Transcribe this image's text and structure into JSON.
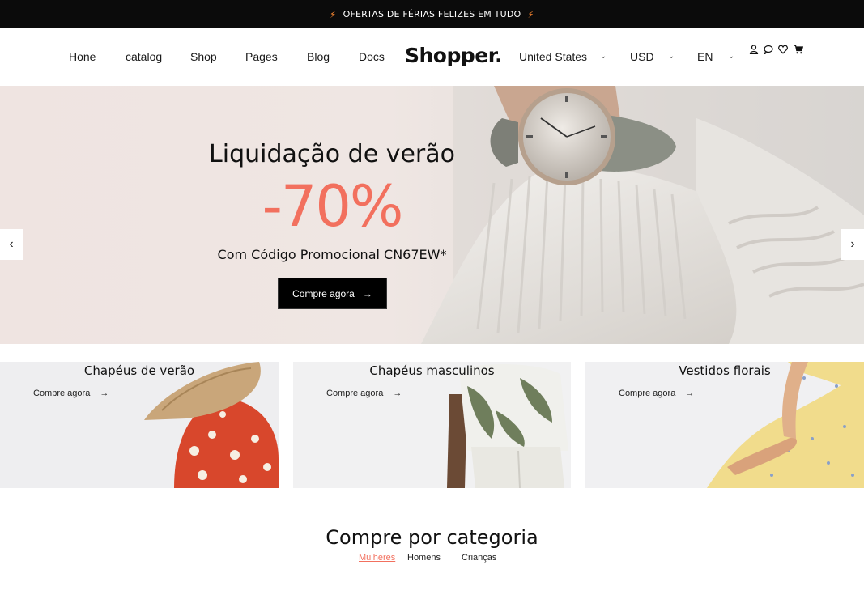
{
  "promo": {
    "text": "OFERTAS DE FÉRIAS FELIZES EM TUDO",
    "bolt": "⚡"
  },
  "nav": {
    "links": [
      "Hone",
      "catalog",
      "Shop",
      "Pages",
      "Blog",
      "Docs"
    ],
    "logo": "Shopper.",
    "country": "United States",
    "currency": "USD",
    "language": "EN",
    "icons": [
      "user-icon",
      "chat-icon",
      "heart-icon",
      "cart-icon"
    ]
  },
  "hero": {
    "title": "Liquidação de verão",
    "discount": "-70%",
    "subtitle": "Com Código Promocional CN67EW*",
    "button": "Compre agora",
    "prev": "‹",
    "next": "›",
    "accent_color": "#f2705e"
  },
  "tiles": [
    {
      "title": "Chapéus de verão",
      "link": "Compre agora"
    },
    {
      "title": "Chapéus masculinos",
      "link": "Compre agora"
    },
    {
      "title": "Vestidos florais",
      "link": "Compre agora"
    }
  ],
  "categories": {
    "title": "Compre por categoria",
    "tabs": [
      "Mulheres",
      "Homens",
      "Crianças"
    ],
    "active_tab": "Mulheres"
  }
}
